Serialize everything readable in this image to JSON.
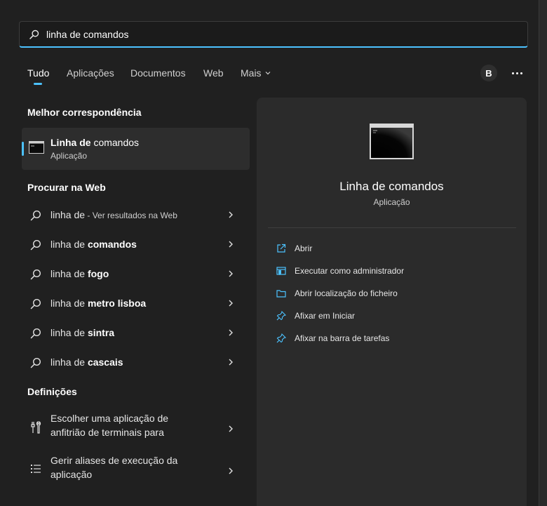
{
  "search": {
    "value": "linha de comandos"
  },
  "tabs": [
    {
      "label": "Tudo"
    },
    {
      "label": "Aplicações"
    },
    {
      "label": "Documentos"
    },
    {
      "label": "Web"
    },
    {
      "label": "Mais"
    }
  ],
  "account": {
    "initial": "B"
  },
  "best_match": {
    "heading": "Melhor correspondência",
    "name_bold": "Linha de",
    "name_rest": " comandos",
    "type": "Aplicação"
  },
  "web": {
    "heading": "Procurar na Web",
    "items": [
      {
        "prefix": "linha de",
        "bold": "",
        "suffix": " - Ver resultados na Web"
      },
      {
        "prefix": "linha de ",
        "bold": "comandos",
        "suffix": ""
      },
      {
        "prefix": "linha de ",
        "bold": "fogo",
        "suffix": ""
      },
      {
        "prefix": "linha de ",
        "bold": "metro lisboa",
        "suffix": ""
      },
      {
        "prefix": "linha de ",
        "bold": "sintra",
        "suffix": ""
      },
      {
        "prefix": "linha de ",
        "bold": "cascais",
        "suffix": ""
      }
    ]
  },
  "settings": {
    "heading": "Definições",
    "items": [
      {
        "line1": "Escolher uma aplicação de",
        "line2": "anfitrião de terminais para"
      },
      {
        "line1": "Gerir aliases de execução da",
        "line2": "aplicação"
      }
    ]
  },
  "preview": {
    "title": "Linha de comandos",
    "subtitle": "Aplicação",
    "actions": [
      {
        "label": "Abrir",
        "icon": "open-external-icon"
      },
      {
        "label": "Executar como administrador",
        "icon": "admin-shield-icon"
      },
      {
        "label": "Abrir localização do ficheiro",
        "icon": "folder-icon"
      },
      {
        "label": "Afixar em Iniciar",
        "icon": "pin-icon"
      },
      {
        "label": "Afixar na barra de tarefas",
        "icon": "pin-icon"
      }
    ]
  },
  "colors": {
    "accent": "#4cc2ff",
    "panel": "#202020",
    "preview_bg": "#2b2b2b"
  }
}
